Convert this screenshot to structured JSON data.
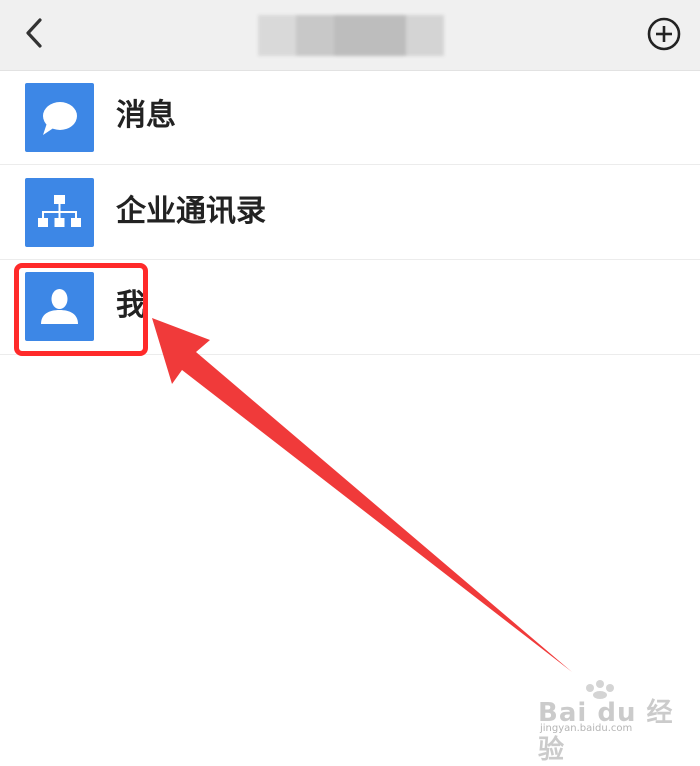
{
  "header": {
    "back_icon": "chevron-left-icon",
    "title": "",
    "add_icon": "plus-circle-icon"
  },
  "menu": [
    {
      "label": "消息",
      "icon": "chat-bubble-icon"
    },
    {
      "label": "企业通讯录",
      "icon": "org-chart-icon"
    },
    {
      "label": "我",
      "icon": "person-icon"
    }
  ],
  "colors": {
    "icon_tile": "#3d87e6",
    "highlight": "#ff2a2a",
    "header_bg": "#f0f0f0"
  },
  "watermark": {
    "brand": "Bai du 经验",
    "sub": "jingyan.baidu.com"
  }
}
